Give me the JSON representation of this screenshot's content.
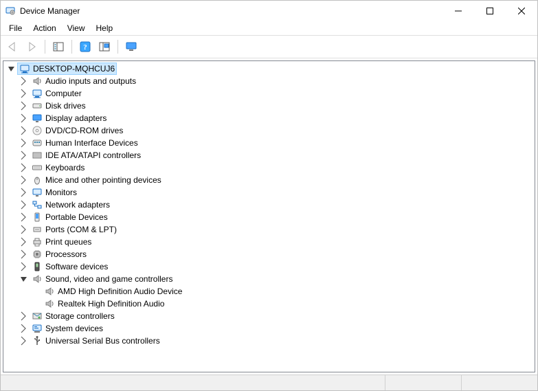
{
  "window": {
    "title": "Device Manager"
  },
  "menu": {
    "file": "File",
    "action": "Action",
    "view": "View",
    "help": "Help"
  },
  "icons": {
    "app": "device-manager-icon",
    "back": "back-arrow-icon",
    "forward": "forward-arrow-icon",
    "show_hide": "show-hide-tree-icon",
    "help": "help-icon",
    "scan": "scan-hardware-icon",
    "monitor": "monitor-icon"
  },
  "tree": {
    "root": {
      "label": "DESKTOP-MQHCUJ6",
      "selected": true,
      "expanded": true
    },
    "categories": [
      {
        "label": "Audio inputs and outputs",
        "icon": "speaker",
        "expanded": false,
        "children": []
      },
      {
        "label": "Computer",
        "icon": "computer",
        "expanded": false,
        "children": []
      },
      {
        "label": "Disk drives",
        "icon": "disk",
        "expanded": false,
        "children": []
      },
      {
        "label": "Display adapters",
        "icon": "display",
        "expanded": false,
        "children": []
      },
      {
        "label": "DVD/CD-ROM drives",
        "icon": "dvd",
        "expanded": false,
        "children": []
      },
      {
        "label": "Human Interface Devices",
        "icon": "hid",
        "expanded": false,
        "children": []
      },
      {
        "label": "IDE ATA/ATAPI controllers",
        "icon": "ide",
        "expanded": false,
        "children": []
      },
      {
        "label": "Keyboards",
        "icon": "keyboard",
        "expanded": false,
        "children": []
      },
      {
        "label": "Mice and other pointing devices",
        "icon": "mouse",
        "expanded": false,
        "children": []
      },
      {
        "label": "Monitors",
        "icon": "monitor",
        "expanded": false,
        "children": []
      },
      {
        "label": "Network adapters",
        "icon": "network",
        "expanded": false,
        "children": []
      },
      {
        "label": "Portable Devices",
        "icon": "portable",
        "expanded": false,
        "children": []
      },
      {
        "label": "Ports (COM & LPT)",
        "icon": "port",
        "expanded": false,
        "children": []
      },
      {
        "label": "Print queues",
        "icon": "printer",
        "expanded": false,
        "children": []
      },
      {
        "label": "Processors",
        "icon": "cpu",
        "expanded": false,
        "children": []
      },
      {
        "label": "Software devices",
        "icon": "software",
        "expanded": false,
        "children": []
      },
      {
        "label": "Sound, video and game controllers",
        "icon": "speaker",
        "expanded": true,
        "children": [
          {
            "label": "AMD High Definition Audio Device",
            "icon": "speaker"
          },
          {
            "label": "Realtek High Definition Audio",
            "icon": "speaker"
          }
        ]
      },
      {
        "label": "Storage controllers",
        "icon": "storage",
        "expanded": false,
        "children": []
      },
      {
        "label": "System devices",
        "icon": "system",
        "expanded": false,
        "children": []
      },
      {
        "label": "Universal Serial Bus controllers",
        "icon": "usb",
        "expanded": false,
        "children": []
      }
    ]
  }
}
